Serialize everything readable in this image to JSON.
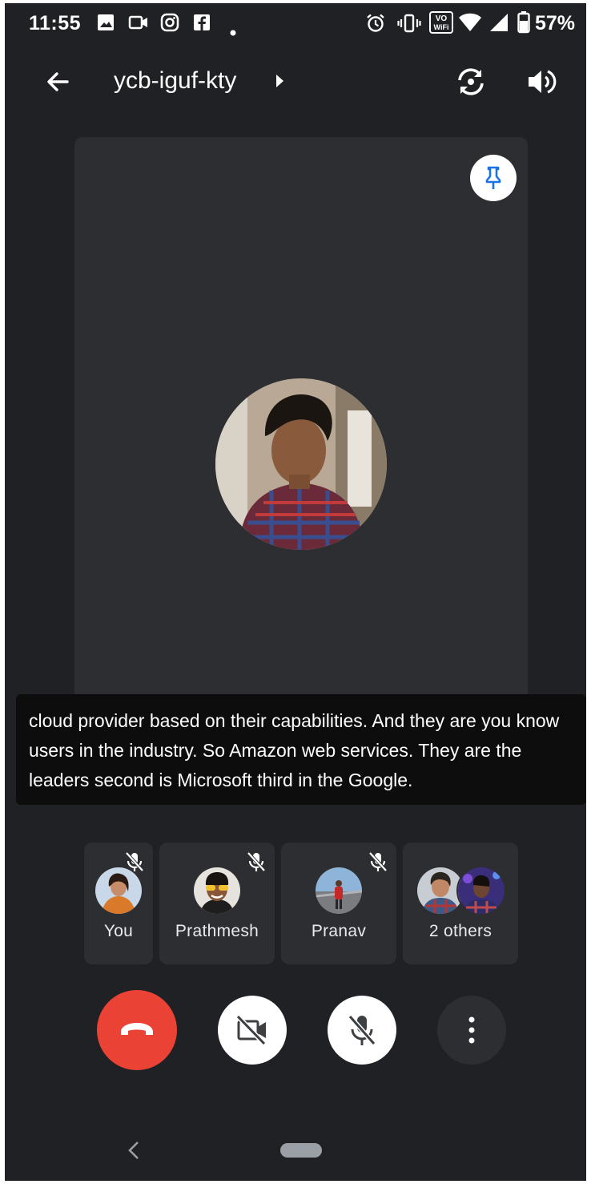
{
  "status_bar": {
    "time": "11:55",
    "battery": "57%",
    "icons": [
      "gallery-icon",
      "video-call-icon",
      "instagram-icon",
      "facebook-icon",
      "dot-icon",
      "alarm-icon",
      "vibrate-icon",
      "vowifi-icon",
      "wifi-icon",
      "signal-icon",
      "battery-icon"
    ],
    "vowifi_top": "VO",
    "vowifi_bottom": "WiFi"
  },
  "app_bar": {
    "meeting_code": "ycb-iguf-kty",
    "icons": [
      "back-arrow-icon",
      "caret-right-icon",
      "switch-camera-icon",
      "speaker-icon"
    ]
  },
  "main_tile": {
    "pin_icon": "pin-icon"
  },
  "caption": {
    "text": "cloud provider based on their capabilities. And they are you know users in the industry. So Amazon web services. They are the leaders second is Microsoft third in the Google."
  },
  "participants": [
    {
      "name": "You",
      "muted": true
    },
    {
      "name": "Prathmesh",
      "muted": true
    },
    {
      "name": "Pranav",
      "muted": true
    },
    {
      "name": "2 others",
      "muted": false
    }
  ],
  "controls": {
    "end_call_color": "#ea4335",
    "items": [
      "end-call-icon",
      "camera-off-icon",
      "mic-off-icon",
      "more-options-icon"
    ]
  },
  "colors": {
    "background": "#202124",
    "tile": "#2d2e31",
    "accent_blue": "#1a73e8",
    "end_call": "#ea4335"
  }
}
